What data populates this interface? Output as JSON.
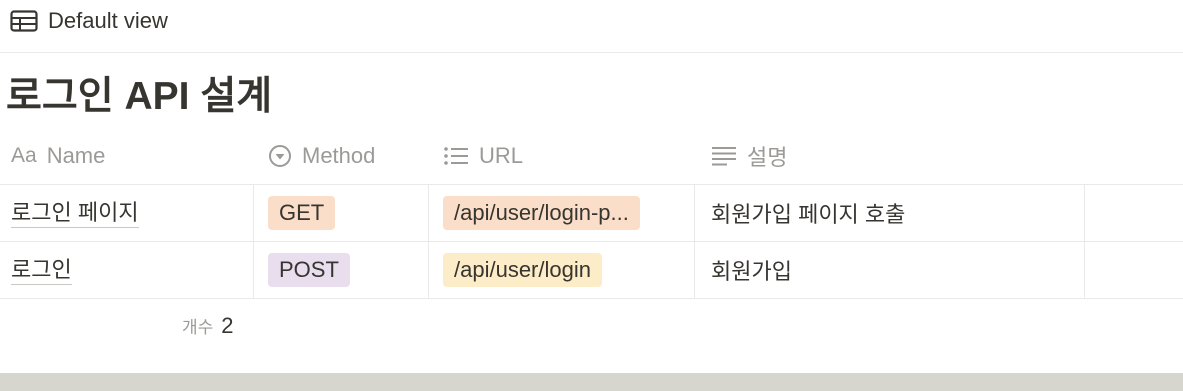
{
  "view": {
    "label": "Default view",
    "icon": "table-icon"
  },
  "database": {
    "title": "로그인 API 설계"
  },
  "columns": [
    {
      "label": "Name",
      "icon": "Aa"
    },
    {
      "label": "Method",
      "icon": "select-icon"
    },
    {
      "label": "URL",
      "icon": "list-icon"
    },
    {
      "label": "설명",
      "icon": "text-lines-icon"
    }
  ],
  "rows": [
    {
      "name": "로그인 페이지",
      "method": "GET",
      "method_color": "#fadec9",
      "url": "/api/user/login-p...",
      "url_color": "#fadec9",
      "desc": "회원가입 페이지 호출"
    },
    {
      "name": "로그인",
      "method": "POST",
      "method_color": "#e8deee",
      "url": "/api/user/login",
      "url_color": "#fdecc8",
      "desc": "회원가입"
    }
  ],
  "footer": {
    "count_label": "개수",
    "count_value": "2"
  }
}
